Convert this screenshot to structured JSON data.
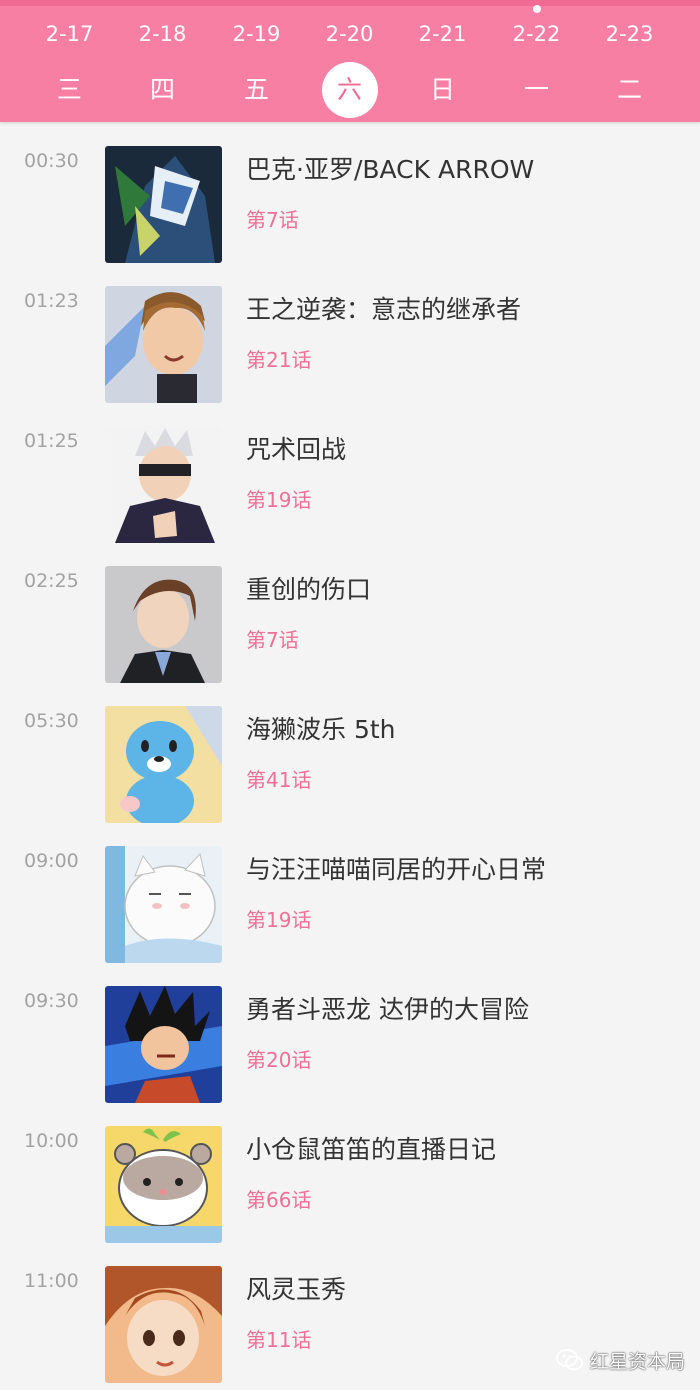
{
  "colors": {
    "accent": "#f77fa3",
    "episode": "#f07098",
    "background": "#f4f4f4"
  },
  "days": [
    {
      "date": "2-17",
      "weekday": "三",
      "selected": false,
      "today": false
    },
    {
      "date": "2-18",
      "weekday": "四",
      "selected": false,
      "today": false
    },
    {
      "date": "2-19",
      "weekday": "五",
      "selected": false,
      "today": false
    },
    {
      "date": "2-20",
      "weekday": "六",
      "selected": true,
      "today": false
    },
    {
      "date": "2-21",
      "weekday": "日",
      "selected": false,
      "today": false
    },
    {
      "date": "2-22",
      "weekday": "一",
      "selected": false,
      "today": true
    },
    {
      "date": "2-23",
      "weekday": "二",
      "selected": false,
      "today": false
    }
  ],
  "schedule": [
    {
      "time": "00:30",
      "title": "巴克·亚罗/BACK ARROW",
      "episode": "第7话",
      "thumb": "back-arrow-cover"
    },
    {
      "time": "01:23",
      "title": "王之逆袭：意志的继承者",
      "episode": "第21话",
      "thumb": "king-cover"
    },
    {
      "time": "01:25",
      "title": "咒术回战",
      "episode": "第19话",
      "thumb": "jujutsu-cover"
    },
    {
      "time": "02:25",
      "title": "重创的伤口",
      "episode": "第7话",
      "thumb": "wound-cover"
    },
    {
      "time": "05:30",
      "title": "海獭波乐 5th",
      "episode": "第41话",
      "thumb": "bono-cover"
    },
    {
      "time": "09:00",
      "title": "与汪汪喵喵同居的开心日常",
      "episode": "第19话",
      "thumb": "dog-cat-cover"
    },
    {
      "time": "09:30",
      "title": "勇者斗恶龙 达伊的大冒险",
      "episode": "第20话",
      "thumb": "dai-cover"
    },
    {
      "time": "10:00",
      "title": "小仓鼠笛笛的直播日记",
      "episode": "第66话",
      "thumb": "hamster-cover"
    },
    {
      "time": "11:00",
      "title": "风灵玉秀",
      "episode": "第11话",
      "thumb": "fengling-cover"
    }
  ],
  "watermark": {
    "text": "红星资本局",
    "icon": "wechat-icon"
  }
}
